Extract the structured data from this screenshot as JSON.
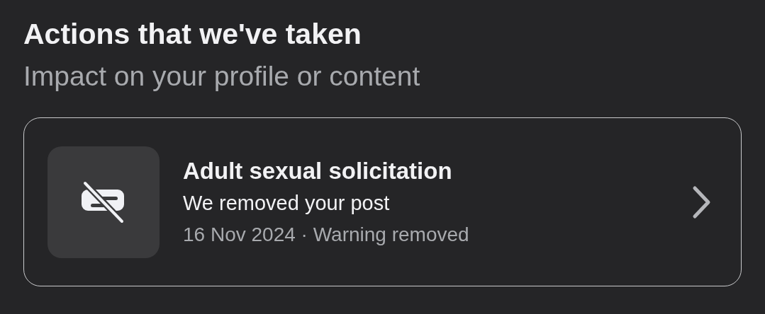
{
  "heading": "Actions that we've taken",
  "subheading": "Impact on your profile or content",
  "actions": [
    {
      "title": "Adult sexual solicitation",
      "description": "We removed your post",
      "meta": "16 Nov 2024 · Warning removed"
    }
  ]
}
